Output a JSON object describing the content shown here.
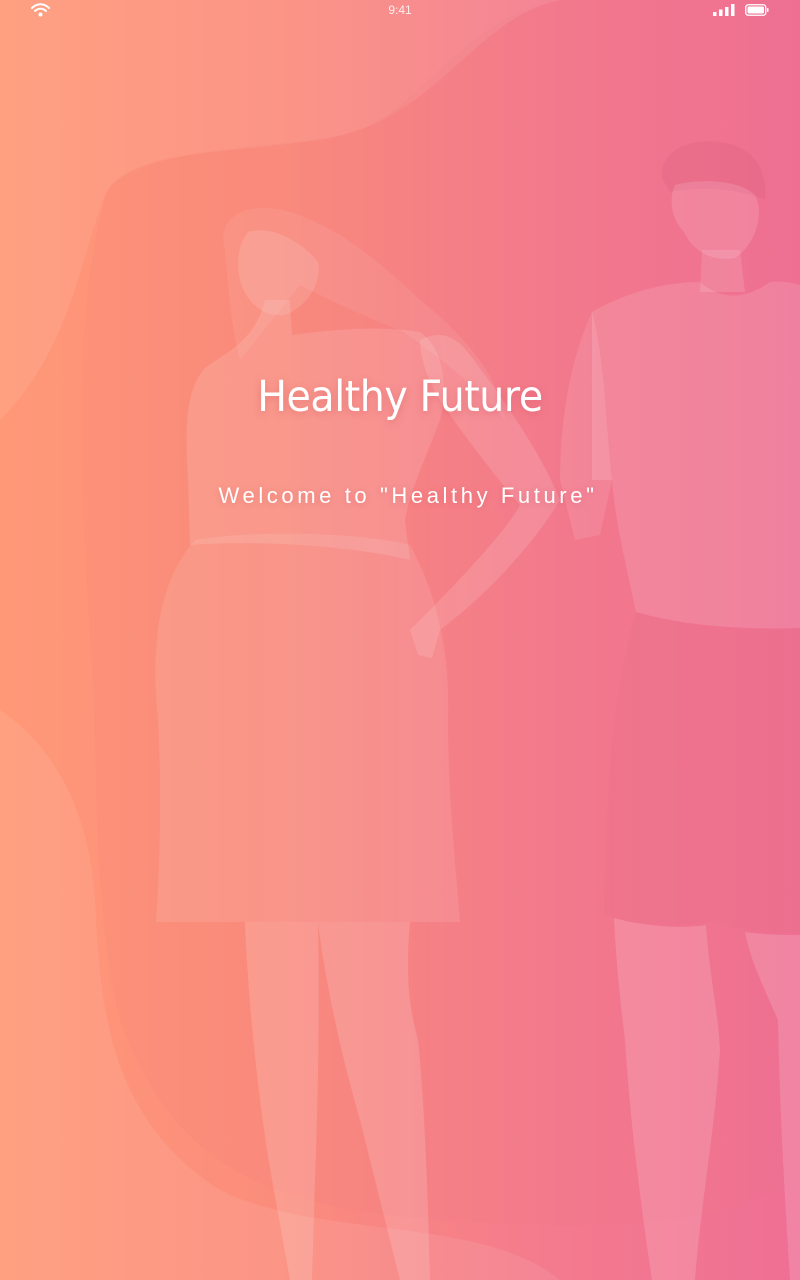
{
  "status_bar": {
    "time": "9:41",
    "icons": [
      "wifi-icon",
      "signal-icon",
      "battery-icon"
    ]
  },
  "splash": {
    "title": "Healthy Future",
    "subtitle": "Welcome to \"Healthy Future\""
  },
  "colors": {
    "gradient_start": "#ff9877",
    "gradient_end": "#ef6f94",
    "text": "#ffffff"
  }
}
